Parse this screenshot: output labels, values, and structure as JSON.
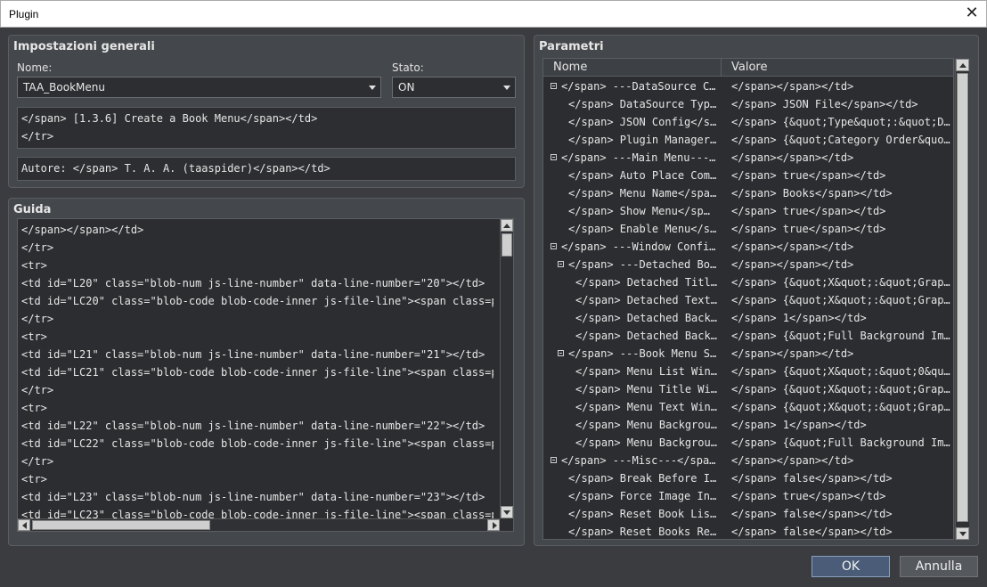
{
  "window": {
    "title": "Plugin",
    "close_glyph": "✕"
  },
  "general": {
    "title": "Impostazioni generali",
    "name_label": "Nome:",
    "name_value": "TAA_BookMenu",
    "state_label": "Stato:",
    "state_value": "ON",
    "description": "</span> [1.3.6] Create a Book Menu</span></td>\n</tr>",
    "author": "Autore: </span> T. A. A. (taaspider)</span></td>"
  },
  "guide": {
    "title": "Guida",
    "lines": [
      "</span></span></td>",
      "</tr>",
      "<tr>",
      "<td id=\"L20\" class=\"blob-num js-line-number\" data-line-number=\"20\"></td>",
      "<td id=\"LC20\" class=\"blob-code blob-code-inner js-file-line\"><span class=pl-c>",
      "</tr>",
      "<tr>",
      "<td id=\"L21\" class=\"blob-num js-line-number\" data-line-number=\"21\"></td>",
      "<td id=\"LC21\" class=\"blob-code blob-code-inner js-file-line\"><span class=pl-c>",
      "</tr>",
      "<tr>",
      "<td id=\"L22\" class=\"blob-num js-line-number\" data-line-number=\"22\"></td>",
      "<td id=\"LC22\" class=\"blob-code blob-code-inner js-file-line\"><span class=pl-c>",
      "</tr>",
      "<tr>",
      "<td id=\"L23\" class=\"blob-num js-line-number\" data-line-number=\"23\"></td>",
      "<td id=\"LC23\" class=\"blob-code blob-code-inner js-file-line\"><span class=pl-c>"
    ]
  },
  "params": {
    "title": "Parametri",
    "col_name": "Nome",
    "col_value": "Valore",
    "rows": [
      {
        "level": 0,
        "toggle": true,
        "name": "</span> ---DataSource Co…",
        "value": "</span></span></td>"
      },
      {
        "level": 1,
        "toggle": false,
        "name": "</span> DataSource Type…",
        "value": "</span> JSON File</span></td>"
      },
      {
        "level": 1,
        "toggle": false,
        "name": "</span> JSON Config</sp…",
        "value": "</span> {&quot;Type&quot;:&quot;De…"
      },
      {
        "level": 1,
        "toggle": false,
        "name": "</span> Plugin Manager …",
        "value": "</span> {&quot;Category Order&quot…"
      },
      {
        "level": 0,
        "toggle": true,
        "name": "</span> ---Main Menu---<…",
        "value": "</span></span></td>"
      },
      {
        "level": 1,
        "toggle": false,
        "name": "</span> Auto Place Comm…",
        "value": "</span> true</span></td>"
      },
      {
        "level": 1,
        "toggle": false,
        "name": "</span> Menu Name</span…",
        "value": "</span> Books</span></td>"
      },
      {
        "level": 1,
        "toggle": false,
        "name": "</span> Show Menu</sp…",
        "value": "</span> true</span></td>"
      },
      {
        "level": 1,
        "toggle": false,
        "name": "</span> Enable Menu</sp…",
        "value": "</span> true</span></td>"
      },
      {
        "level": 0,
        "toggle": true,
        "name": "</span> ---Window Config…",
        "value": "</span></span></td>"
      },
      {
        "level": 1,
        "toggle": true,
        "name": "</span> ---Detached Boo…",
        "value": "</span></span></td>"
      },
      {
        "level": 2,
        "toggle": false,
        "name": "</span> Detached Title…",
        "value": "</span> {&quot;X&quot;:&quot;Graph…"
      },
      {
        "level": 2,
        "toggle": false,
        "name": "</span> Detached Text …",
        "value": "</span> {&quot;X&quot;:&quot;Graph…"
      },
      {
        "level": 2,
        "toggle": false,
        "name": "</span> Detached Backg…",
        "value": "</span> 1</span></td>"
      },
      {
        "level": 2,
        "toggle": false,
        "name": "</span> Detached Backg…",
        "value": "</span> {&quot;Full Background Ima…"
      },
      {
        "level": 1,
        "toggle": true,
        "name": "</span> ---Book Menu Sc…",
        "value": "</span></span></td>"
      },
      {
        "level": 2,
        "toggle": false,
        "name": "</span> Menu List Wind…",
        "value": "</span> {&quot;X&quot;:&quot;0&quo…"
      },
      {
        "level": 2,
        "toggle": false,
        "name": "</span> Menu Title Win…",
        "value": "</span> {&quot;X&quot;:&quot;Graph…"
      },
      {
        "level": 2,
        "toggle": false,
        "name": "</span> Menu Text Wind…",
        "value": "</span> {&quot;X&quot;:&quot;Graph…"
      },
      {
        "level": 2,
        "toggle": false,
        "name": "</span> Menu Backgroun…",
        "value": "</span> 1</span></td>"
      },
      {
        "level": 2,
        "toggle": false,
        "name": "</span> Menu Backgroun…",
        "value": "</span> {&quot;Full Background Ima…"
      },
      {
        "level": 0,
        "toggle": true,
        "name": "</span> ---Misc---</span…",
        "value": "</span></span></td>"
      },
      {
        "level": 1,
        "toggle": false,
        "name": "</span> Break Before Im…",
        "value": "</span> false</span></td>"
      },
      {
        "level": 1,
        "toggle": false,
        "name": "</span> Force Image Int…",
        "value": "</span> true</span></td>"
      },
      {
        "level": 1,
        "toggle": false,
        "name": "</span> Reset Book List…",
        "value": "</span> false</span></td>"
      },
      {
        "level": 1,
        "toggle": false,
        "name": "</span> Reset Books Rea…",
        "value": "</span> false</span></td>"
      }
    ]
  },
  "buttons": {
    "ok": "OK",
    "cancel": "Annulla"
  }
}
